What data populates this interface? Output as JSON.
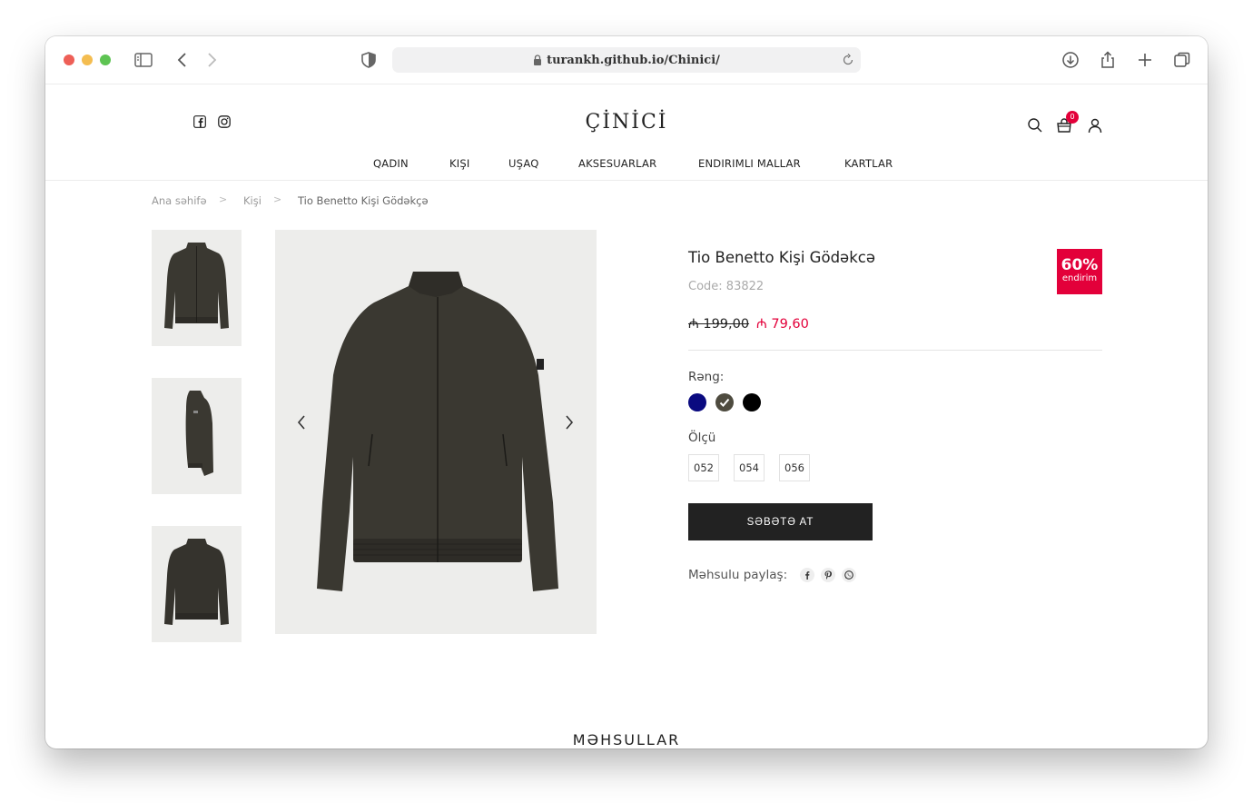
{
  "browser": {
    "url": "turankh.github.io/Chinici/"
  },
  "site": {
    "logo": "ÇİNİCİ",
    "cart_count": "0"
  },
  "nav": [
    {
      "label": "QADIN"
    },
    {
      "label": "KIŞI"
    },
    {
      "label": "UŞAQ"
    },
    {
      "label": "AKSESUARLAR"
    },
    {
      "label": "ENDIRIMLI MALLAR"
    },
    {
      "label": "KARTLAR"
    }
  ],
  "breadcrumb": {
    "home": "Ana səhifə",
    "category": "Kişi",
    "current": "Tio Benetto Kişi Gödəkçə",
    "separator": ">"
  },
  "product": {
    "title": "Tio Benetto Kişi Gödəkcə",
    "code": "Code: 83822",
    "old_price": "₼ 199,00",
    "new_price": "₼ 79,60",
    "discount_pct": "60%",
    "discount_label": "endirim",
    "color_label": "Rəng:",
    "colors": [
      {
        "name": "navy",
        "hex": "#0a0a80",
        "selected": false
      },
      {
        "name": "olive",
        "hex": "#4e4b3f",
        "selected": true
      },
      {
        "name": "black",
        "hex": "#000000",
        "selected": false
      }
    ],
    "size_label": "Ölçü",
    "sizes": [
      "052",
      "054",
      "056"
    ],
    "add_to_cart": "SƏBƏTƏ AT",
    "share_label": "Məhsulu paylaş:",
    "jacket_color": "#3a3831"
  },
  "section": {
    "title": "MƏHSULLAR"
  }
}
